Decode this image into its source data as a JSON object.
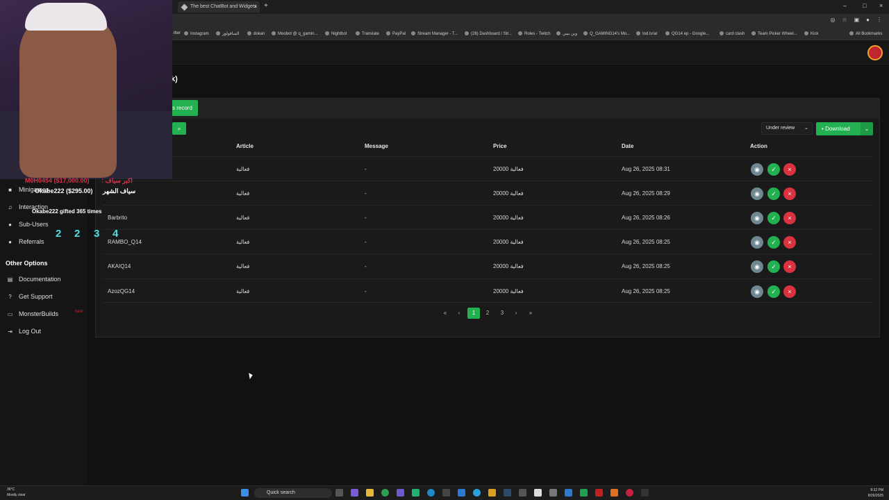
{
  "browser": {
    "active_tab_title": "The best ChatBot and Widgets",
    "new_tab_symbol": "+",
    "close_symbol": "×",
    "window_controls": [
      "–",
      "□",
      "×"
    ],
    "bookmarks": [
      "itter",
      "Instagram",
      "الساقولوز",
      "dokan",
      "Moobot @ q_gamin...",
      "Nightbot",
      "Translate",
      "PayPal",
      "Stream Manager - T...",
      "(28) Dashboard / Str...",
      "Roles - Twitch",
      "وين بيبي",
      "Q_GAMING14's Mo...",
      "tod.tv/ar",
      "QG14 ep - Google...",
      "card clash",
      "Team Picker Wheel...",
      "Kick"
    ],
    "all_bookmarks": "All Bookmarks"
  },
  "page": {
    "title_fragment": "k)",
    "add_record_label": "s record"
  },
  "sidebar": {
    "items": [
      {
        "label": "Minigames",
        "icon": "gamepad-icon"
      },
      {
        "label": "Interaction",
        "icon": "music-icon"
      },
      {
        "label": "Sub-Users",
        "icon": "users-icon"
      },
      {
        "label": "Referrals",
        "icon": "users-icon"
      }
    ],
    "other_options_heading": "Other Options",
    "other_items": [
      {
        "label": "Documentation",
        "icon": "book-icon"
      },
      {
        "label": "Get Support",
        "icon": "help-icon"
      },
      {
        "label": "MonsterBuilds",
        "icon": "monitor-icon",
        "badge": "NEW"
      },
      {
        "label": "Log Out",
        "icon": "logout-icon"
      }
    ]
  },
  "filters": {
    "status_selected": "Under review",
    "download_label": "Download"
  },
  "table": {
    "headers": {
      "article": "Article",
      "message": "Message",
      "price": "Price",
      "date": "Date",
      "action": "Action"
    },
    "rows": [
      {
        "user": "",
        "article": "فعالية",
        "message": "-",
        "price": "20000 فعالية",
        "date": "Aug 26, 2025 08:31"
      },
      {
        "user": "",
        "article": "فعالية",
        "message": "-",
        "price": "20000 فعالية",
        "date": "Aug 26, 2025 08:29"
      },
      {
        "user": "Barbrito",
        "article": "فعالية",
        "message": "-",
        "price": "20000 فعالية",
        "date": "Aug 26, 2025 08:26"
      },
      {
        "user": "RAMBO_Q14",
        "article": "فعالية",
        "message": "-",
        "price": "20000 فعالية",
        "date": "Aug 26, 2025 08:25"
      },
      {
        "user": "AKAIQ14",
        "article": "فعالية",
        "message": "-",
        "price": "20000 فعالية",
        "date": "Aug 26, 2025 08:25"
      },
      {
        "user": "AzozQG14",
        "article": "فعالية",
        "message": "-",
        "price": "20000 فعالية",
        "date": "Aug 26, 2025 08:25"
      }
    ]
  },
  "pagination": {
    "first": "«",
    "prev": "‹",
    "pages": [
      "1",
      "2",
      "3"
    ],
    "current": "1",
    "next": "›",
    "last": "»"
  },
  "stream_overlay": {
    "top_donation": "M0H0454 ($17,000.00)",
    "top_donation_label": ": اكبر سياف",
    "month_label": "سياف الشهر",
    "month_donation": "Okabe222 ($295.00)",
    "gifts_line": "Okabe222 gifted 365 times",
    "hype_numbers": [
      "2",
      "2",
      "3",
      "4"
    ]
  },
  "taskbar": {
    "temperature": "36°C",
    "weather": "Mostly clear",
    "search_label": "Quick search",
    "time": "8:32 PM",
    "date": "8/26/2025"
  },
  "colors": {
    "accent_green": "#22b050",
    "danger_red": "#d9333f",
    "view_gray": "#6f8791"
  }
}
